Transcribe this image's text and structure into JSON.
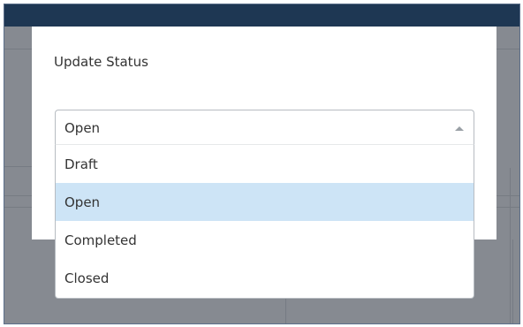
{
  "dialog": {
    "title": "Update Status"
  },
  "status_select": {
    "value": "Open",
    "caret_icon": "caret-up-icon",
    "options": [
      {
        "label": "Draft",
        "selected": false
      },
      {
        "label": "Open",
        "selected": true
      },
      {
        "label": "Completed",
        "selected": false
      },
      {
        "label": "Closed",
        "selected": false
      }
    ]
  },
  "colors": {
    "header": "#1e3753",
    "overlay": "#868a91",
    "option_highlight": "#cde4f6"
  }
}
